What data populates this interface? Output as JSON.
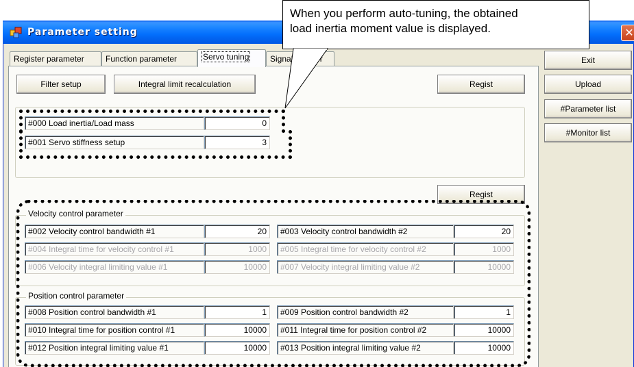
{
  "window": {
    "title": "Parameter setting",
    "close_glyph": "✕"
  },
  "tabs": [
    {
      "label": "Register parameter"
    },
    {
      "label": "Function parameter"
    },
    {
      "label": "Servo tuning"
    },
    {
      "label": "Signal monitor"
    }
  ],
  "toolbar": {
    "filter_setup": "Filter setup",
    "integral_limit": "Integral limit recalculation",
    "regist": "Regist"
  },
  "side_buttons": {
    "exit": "Exit",
    "upload": "Upload",
    "parameter_list": "#Parameter list",
    "monitor_list": "#Monitor list"
  },
  "inertia_group": {
    "rows": [
      {
        "label": "#000  Load inertia/Load mass",
        "value": "0"
      },
      {
        "label": "#001  Servo stiffness setup",
        "value": "3"
      }
    ]
  },
  "regist2": "Regist",
  "velocity_group": {
    "title": "Velocity control parameter",
    "left": [
      {
        "label": "#002  Velocity control bandwidth #1",
        "value": "20"
      },
      {
        "label": "#004  Integral time for velocity control #1",
        "value": "1000"
      },
      {
        "label": "#006  Velocity integral limiting value #1",
        "value": "10000"
      }
    ],
    "right": [
      {
        "label": "#003  Velocity control bandwidth #2",
        "value": "20"
      },
      {
        "label": "#005  Integral time for velocity control #2",
        "value": "1000"
      },
      {
        "label": "#007  Velocity integral limiting value #2",
        "value": "10000"
      }
    ]
  },
  "position_group": {
    "title": "Position control parameter",
    "left": [
      {
        "label": "#008  Position control bandwidth #1",
        "value": "1"
      },
      {
        "label": "#010  Integral time for position control #1",
        "value": "10000"
      },
      {
        "label": "#012  Position integral limiting value #1",
        "value": "10000"
      }
    ],
    "right": [
      {
        "label": "#009  Position control bandwidth #2",
        "value": "1"
      },
      {
        "label": "#011  Integral time for position control #2",
        "value": "10000"
      },
      {
        "label": "#013  Position integral limiting value #2",
        "value": "10000"
      }
    ]
  },
  "callout": {
    "line1": "When you perform auto-tuning, the obtained",
    "line2": "load inertia moment value is displayed."
  },
  "colors": {
    "titlebar": "#0058ee",
    "window_bg": "#ece9d8",
    "panel_bg": "#fbfbf8",
    "disabled_text": "#a7a6aa"
  }
}
